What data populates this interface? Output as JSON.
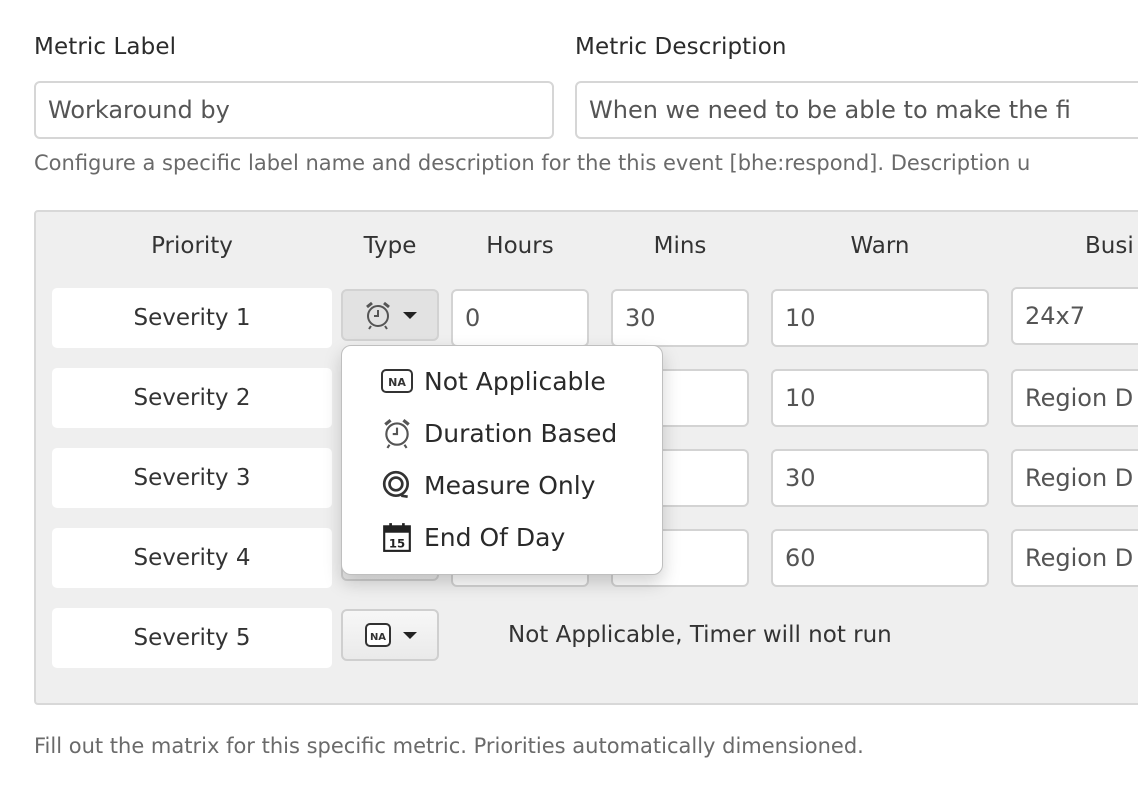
{
  "metric_label": {
    "label": "Metric Label",
    "value": "Workaround by"
  },
  "metric_description": {
    "label": "Metric Description",
    "value": "When we  need to be able to make the fi"
  },
  "config_help": "Configure a specific label name and description for the this event [bhe:respond]. Description u",
  "matrix": {
    "headers": {
      "priority": "Priority",
      "type": "Type",
      "hours": "Hours",
      "mins": "Mins",
      "warn": "Warn",
      "business": "Busi"
    },
    "rows": [
      {
        "priority": "Severity 1",
        "type_icon": "alarm-clock-icon",
        "hours": "0",
        "mins": "30",
        "warn": "10",
        "business": "24x7"
      },
      {
        "priority": "Severity 2",
        "type_icon": "hidden",
        "hours": "",
        "mins": "",
        "warn": "10",
        "business": "Region D"
      },
      {
        "priority": "Severity 3",
        "type_icon": "hidden",
        "hours": "",
        "mins": "",
        "warn": "30",
        "business": "Region D"
      },
      {
        "priority": "Severity 4",
        "type_icon": "hidden",
        "hours": "",
        "mins": "",
        "warn": "60",
        "business": "Region D"
      },
      {
        "priority": "Severity 5",
        "type_icon": "na-icon",
        "note": "Not Applicable, Timer will not run"
      }
    ]
  },
  "type_menu": {
    "items": [
      {
        "label": "Not Applicable",
        "icon": "na-icon"
      },
      {
        "label": "Duration Based",
        "icon": "alarm-clock-icon"
      },
      {
        "label": "Measure Only",
        "icon": "measure-icon"
      },
      {
        "label": "End Of Day",
        "icon": "calendar-icon",
        "icon_text": "15"
      }
    ]
  },
  "matrix_help": "Fill out the matrix for this specific metric. Priorities automatically dimensioned."
}
